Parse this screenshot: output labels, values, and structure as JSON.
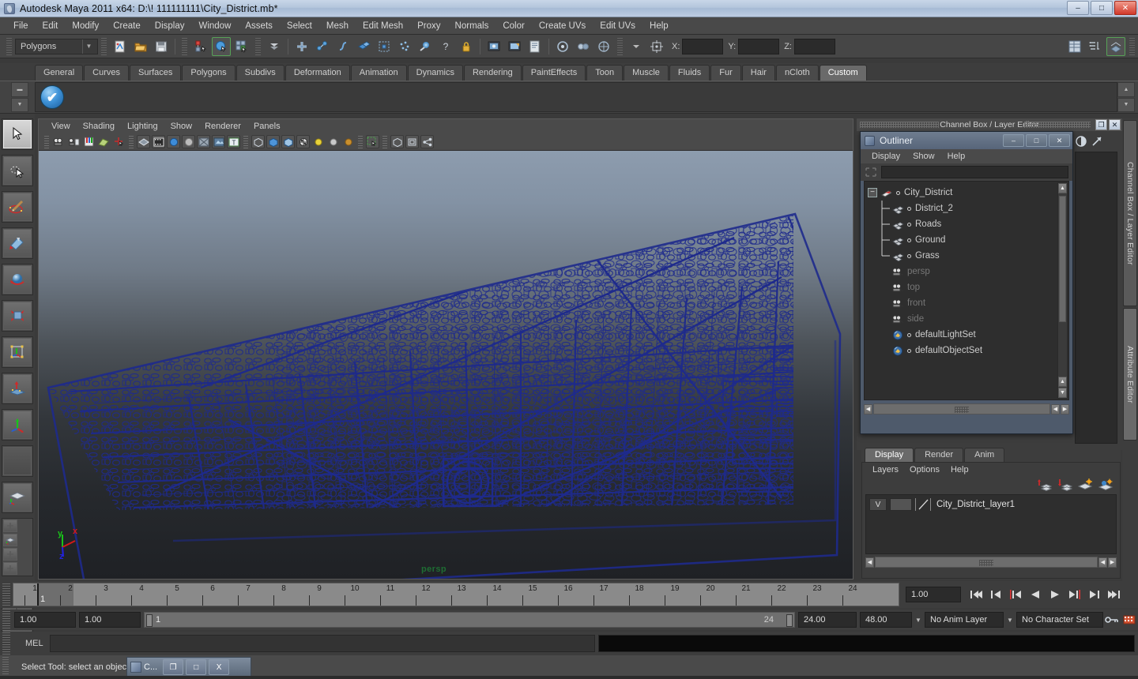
{
  "window": {
    "title": "Autodesk Maya 2011 x64: D:\\! 111111111\\City_District.mb*",
    "app_icon": "maya-logo-icon",
    "minimize": "–",
    "maximize": "□",
    "close": "✕"
  },
  "menubar": {
    "items": [
      "File",
      "Edit",
      "Modify",
      "Create",
      "Display",
      "Window",
      "Assets",
      "Select",
      "Mesh",
      "Edit Mesh",
      "Proxy",
      "Normals",
      "Color",
      "Create UVs",
      "Edit UVs",
      "Help"
    ]
  },
  "toolbar": {
    "menuset": "Polygons",
    "menuset_arrow": "▼",
    "coord_x_label": "X:",
    "coord_y_label": "Y:",
    "coord_z_label": "Z:",
    "coord_x_value": "",
    "coord_y_value": "",
    "coord_z_value": ""
  },
  "shelf": {
    "tabs": [
      "General",
      "Curves",
      "Surfaces",
      "Polygons",
      "Subdivs",
      "Deformation",
      "Animation",
      "Dynamics",
      "Rendering",
      "PaintEffects",
      "Toon",
      "Muscle",
      "Fluids",
      "Fur",
      "Hair",
      "nCloth",
      "Custom"
    ],
    "active_tab": "Custom",
    "button_icon": "blue-checkmark-icon"
  },
  "viewport": {
    "menus": [
      "View",
      "Shading",
      "Lighting",
      "Show",
      "Renderer",
      "Panels"
    ],
    "camera_label": "persp",
    "axis": {
      "x": "x",
      "y": "y",
      "z": "z",
      "x_color": "#d41919",
      "y_color": "#19c419",
      "z_color": "#2222e0"
    },
    "wireframe_color": "#1e2a8c",
    "background_top": "#8d9cae",
    "background_bottom": "#1f2125"
  },
  "channelbox": {
    "header_title": "Channel Box / Layer Editor",
    "restore_icon": "restore-icon",
    "close_icon": "close-icon"
  },
  "outliner": {
    "title": "Outliner",
    "icon": "maya-logo-icon",
    "minimize": "–",
    "maximize": "□",
    "close": "✕",
    "menus": [
      "Display",
      "Show",
      "Help"
    ],
    "search_value": "",
    "items": [
      {
        "label": "City_District",
        "indent": 0,
        "dim": false,
        "icon": "transform-icon",
        "expander": "−"
      },
      {
        "label": "District_2",
        "indent": 1,
        "dim": false,
        "icon": "mesh-icon",
        "expander": ""
      },
      {
        "label": "Roads",
        "indent": 1,
        "dim": false,
        "icon": "mesh-icon",
        "expander": ""
      },
      {
        "label": "Ground",
        "indent": 1,
        "dim": false,
        "icon": "mesh-icon",
        "expander": ""
      },
      {
        "label": "Grass",
        "indent": 1,
        "dim": false,
        "icon": "mesh-icon",
        "expander": ""
      },
      {
        "label": "persp",
        "indent": 1,
        "dim": true,
        "icon": "camera-icon",
        "expander": ""
      },
      {
        "label": "top",
        "indent": 1,
        "dim": true,
        "icon": "camera-icon",
        "expander": ""
      },
      {
        "label": "front",
        "indent": 1,
        "dim": true,
        "icon": "camera-icon",
        "expander": ""
      },
      {
        "label": "side",
        "indent": 1,
        "dim": true,
        "icon": "camera-icon",
        "expander": ""
      },
      {
        "label": "defaultLightSet",
        "indent": 1,
        "dim": false,
        "icon": "set-icon",
        "expander": ""
      },
      {
        "label": "defaultObjectSet",
        "indent": 1,
        "dim": false,
        "icon": "set-icon",
        "expander": ""
      }
    ]
  },
  "layereditor": {
    "tabs": [
      "Display",
      "Render",
      "Anim"
    ],
    "active_tab": "Display",
    "menus": [
      "Layers",
      "Options",
      "Help"
    ],
    "buttons": [
      "move-layer-up-icon",
      "move-layer-down-icon",
      "new-layer-icon",
      "new-layer-from-selected-icon"
    ],
    "layers": [
      {
        "visibility": "V",
        "playback": "",
        "type": "",
        "name": "City_District_layer1"
      }
    ]
  },
  "side_tabs": {
    "items": [
      "Channel Box / Layer Editor",
      "Attribute Editor"
    ],
    "active": "Attribute Editor"
  },
  "timeline": {
    "ticks": [
      "1",
      "2",
      "3",
      "4",
      "5",
      "6",
      "7",
      "8",
      "9",
      "10",
      "11",
      "12",
      "13",
      "14",
      "15",
      "16",
      "17",
      "18",
      "19",
      "20",
      "21",
      "22",
      "23",
      "24"
    ],
    "current_frame_label": "1",
    "current_frame_field": "1.00",
    "playback_buttons": [
      "go-to-start-icon",
      "step-back-keyframe-icon",
      "step-back-frame-icon",
      "play-backwards-icon",
      "play-forwards-icon",
      "step-forward-frame-icon",
      "step-forward-keyframe-icon",
      "go-to-end-icon"
    ]
  },
  "rangebar": {
    "start_field": "1.00",
    "end_field": "1.00",
    "range_start_label": "1",
    "range_end_label": "24",
    "anim_start": "24.00",
    "anim_end": "48.00",
    "anim_layer": "No Anim Layer",
    "character_set": "No Character Set",
    "key_icon": "key-icon",
    "autokey_icon": "auto-key-icon",
    "prefs_icon": "animation-preferences-icon"
  },
  "melbar": {
    "label": "MEL",
    "command_value": "",
    "output_value": ""
  },
  "statusbar": {
    "message": "Select Tool: select an object",
    "task_label": "C...",
    "task_icon": "maya-logo-icon",
    "task_restore": "❐",
    "task_maximize": "□",
    "task_close": "X"
  },
  "toolbox": {
    "tools": [
      "select-tool-icon",
      "lasso-select-tool-icon",
      "paint-select-tool-icon",
      "move-tool-icon",
      "rotate-tool-icon",
      "scale-tool-icon",
      "universal-manipulator-icon",
      "soft-modification-tool-icon",
      "last-tool-used-icon",
      "blank-slot-icon"
    ],
    "layouts": [
      "single-perspective-layout-icon",
      "four-view-layout-icon",
      "outliner-persp-layout-icon",
      "persp-graph-layout-icon",
      "hypershade-layout-icon"
    ]
  }
}
